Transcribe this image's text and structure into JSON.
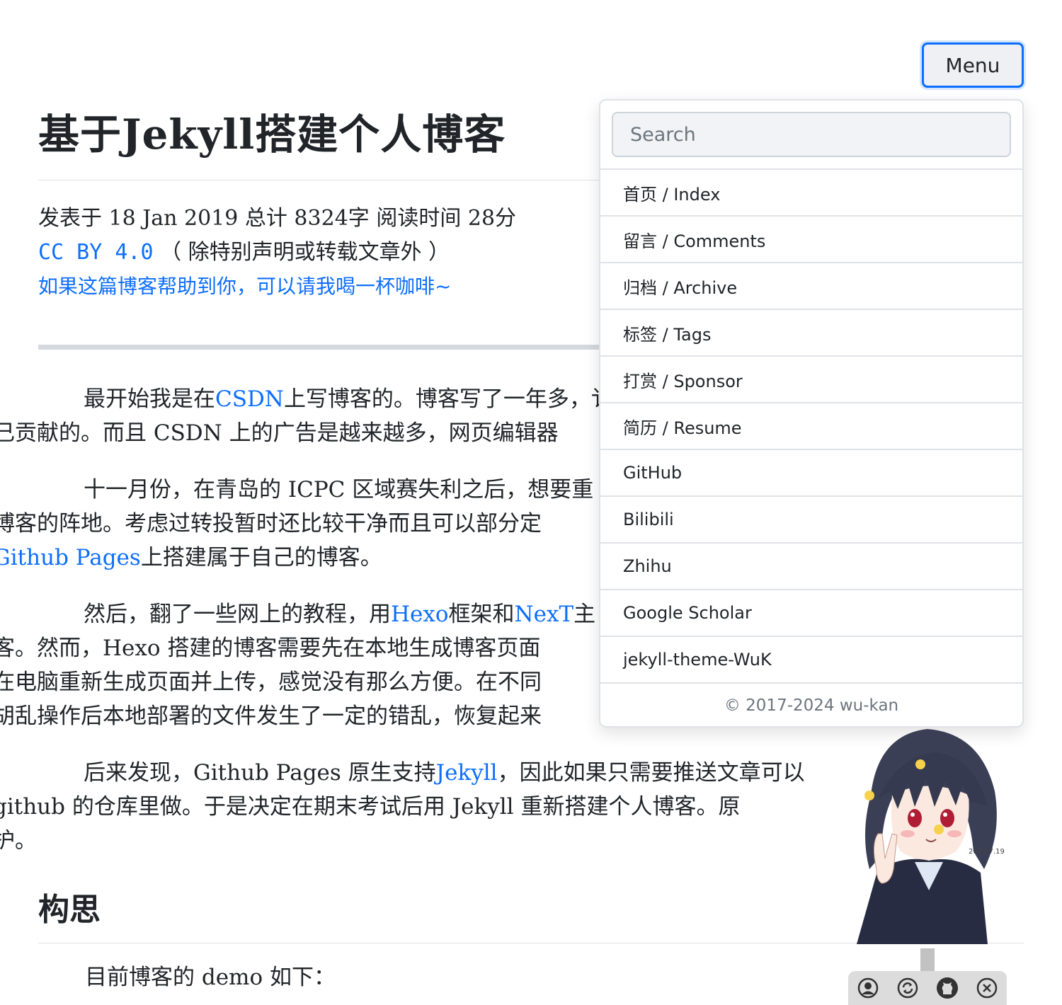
{
  "menu_button": {
    "label": "Menu"
  },
  "post": {
    "title": "基于Jekyll搭建个人博客",
    "meta_prefix": "发表于 18 Jan 2019 总计 8324字 阅读时间 28分",
    "license_link": "CC BY 4.0",
    "license_note": "（ 除特别声明或转载文章外 ）",
    "sponsor_link": "如果这篇博客帮助到你，可以请我喝一杯咖啡~"
  },
  "paragraphs": {
    "p1": {
      "a": "最开始我是在",
      "csdn": "CSDN",
      "b": "上写博客的。博客写了一年多，",
      "c": "讠",
      "line2": "己贡献的。而且 CSDN 上的广告是越来越多，网页编辑器"
    },
    "p2": {
      "line1": "十一月份，在青岛的 ICPC 区域赛失利之后，想要重",
      "line2": "博客的阵地。考虑过转投暂时还比较干净而且可以部分定",
      "gh_link": "Github Pages",
      "line3": "上搭建属于自己的博客。"
    },
    "p3": {
      "a": "然后，翻了一些网上的教程，用",
      "hexo": "Hexo",
      "b": "框架和",
      "next": "NexT",
      "c": "主",
      "line2": "客。然而，Hexo 搭建的博客需要先在本地生成博客页面",
      "line3": "在电脑重新生成页面并上传，感觉没有那么方便。在不同",
      "line4": "胡乱操作后本地部署的文件发生了一定的错乱，恢复起来"
    },
    "p4": {
      "a": "后来发现，Github Pages 原生支持",
      "jekyll": "Jekyll",
      "b": "，因此如果只需要推送文章可以",
      "line2": "github 的仓库里做。于是决定在期末考试后用 Jekyll 重新搭建个人博客。原",
      "line3": "护。"
    }
  },
  "section": {
    "title": "构思"
  },
  "demo_line": "目前博客的 demo 如下：",
  "dropdown": {
    "search_placeholder": "Search",
    "items": [
      "首页 / Index",
      "留言 / Comments",
      "归档 / Archive",
      "标签 / Tags",
      "打赏 / Sponsor",
      "简历 / Resume",
      "GitHub",
      "Bilibili",
      "Zhihu",
      "Google Scholar",
      "jekyll-theme-WuK"
    ],
    "copyright": "© 2017-2024 wu-kan"
  },
  "mascot": {
    "date_signature": "2019.7.19"
  },
  "tools": [
    "user-icon",
    "refresh-icon",
    "github-icon",
    "close-icon"
  ],
  "colors": {
    "link": "#0d6efd",
    "text": "#212529",
    "border": "#dfe2e6"
  }
}
